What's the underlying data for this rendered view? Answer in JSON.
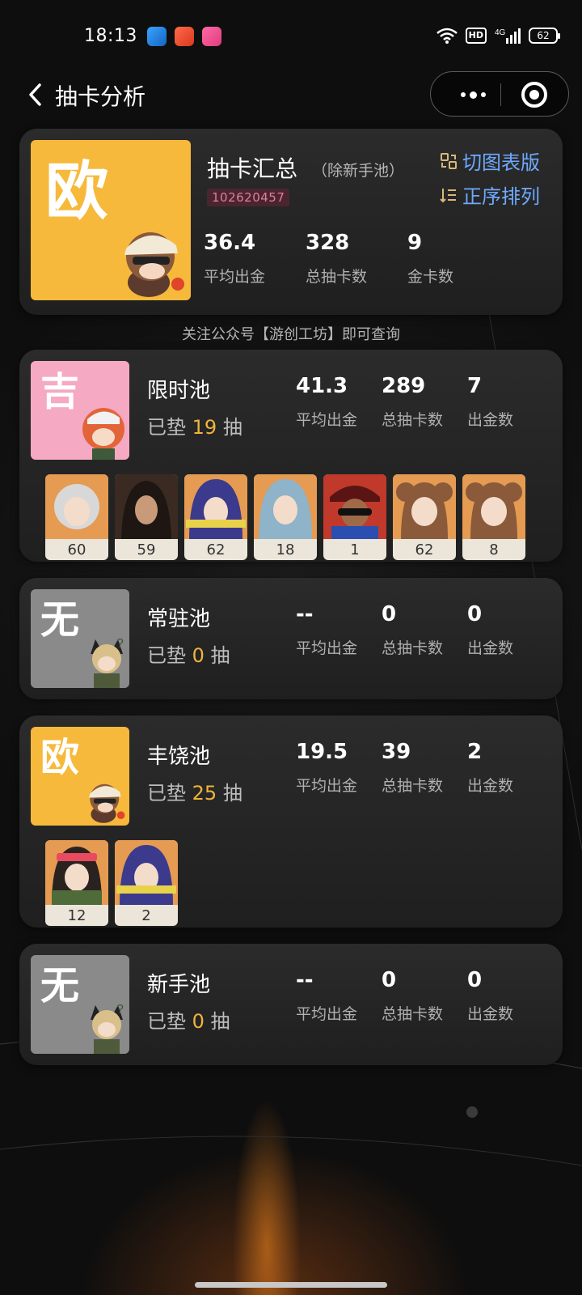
{
  "status_bar": {
    "time": "18:13",
    "network": "4G",
    "hd": "HD",
    "battery": "62"
  },
  "nav": {
    "title": "抽卡分析"
  },
  "summary": {
    "grade": "欧",
    "title": "抽卡汇总",
    "subtitle": "（除新手池）",
    "uid": "102620457",
    "switch_label": "切图表版",
    "sort_label": "正序排列",
    "stats": [
      {
        "value": "36.4",
        "label": "平均出金"
      },
      {
        "value": "328",
        "label": "总抽卡数"
      },
      {
        "value": "9",
        "label": "金卡数"
      }
    ]
  },
  "notice": "关注公众号【游创工坊】即可查询",
  "pools": [
    {
      "grade": "吉",
      "grade_color": "#f5a9c2",
      "name": "限时池",
      "pity_prefix": "已垫 ",
      "pity": "19",
      "pity_suffix": " 抽",
      "stats": [
        {
          "value": "41.3",
          "label": "平均出金"
        },
        {
          "value": "289",
          "label": "总抽卡数"
        },
        {
          "value": "7",
          "label": "出金数"
        }
      ],
      "characters": [
        "60",
        "59",
        "62",
        "18",
        "1",
        "62",
        "8"
      ]
    },
    {
      "grade": "无",
      "grade_color": "#8a8a8a",
      "name": "常驻池",
      "pity_prefix": "已垫 ",
      "pity": "0",
      "pity_suffix": " 抽",
      "stats": [
        {
          "value": "--",
          "label": "平均出金"
        },
        {
          "value": "0",
          "label": "总抽卡数"
        },
        {
          "value": "0",
          "label": "出金数"
        }
      ],
      "characters": []
    },
    {
      "grade": "欧",
      "grade_color": "#f6b93b",
      "name": "丰饶池",
      "pity_prefix": "已垫 ",
      "pity": "25",
      "pity_suffix": " 抽",
      "stats": [
        {
          "value": "19.5",
          "label": "平均出金"
        },
        {
          "value": "39",
          "label": "总抽卡数"
        },
        {
          "value": "2",
          "label": "出金数"
        }
      ],
      "characters": [
        "12",
        "2"
      ]
    },
    {
      "grade": "无",
      "grade_color": "#8a8a8a",
      "name": "新手池",
      "pity_prefix": "已垫 ",
      "pity": "0",
      "pity_suffix": " 抽",
      "stats": [
        {
          "value": "--",
          "label": "平均出金"
        },
        {
          "value": "0",
          "label": "总抽卡数"
        },
        {
          "value": "0",
          "label": "出金数"
        }
      ],
      "characters": []
    }
  ],
  "colors": {
    "accent_link": "#6fa9ff",
    "pity_highlight": "#f0b43a",
    "uid_text": "#e07da0"
  },
  "icons": [
    "chevron-left-icon",
    "more-dots-icon",
    "target-icon",
    "switch-icon",
    "sort-icon"
  ]
}
